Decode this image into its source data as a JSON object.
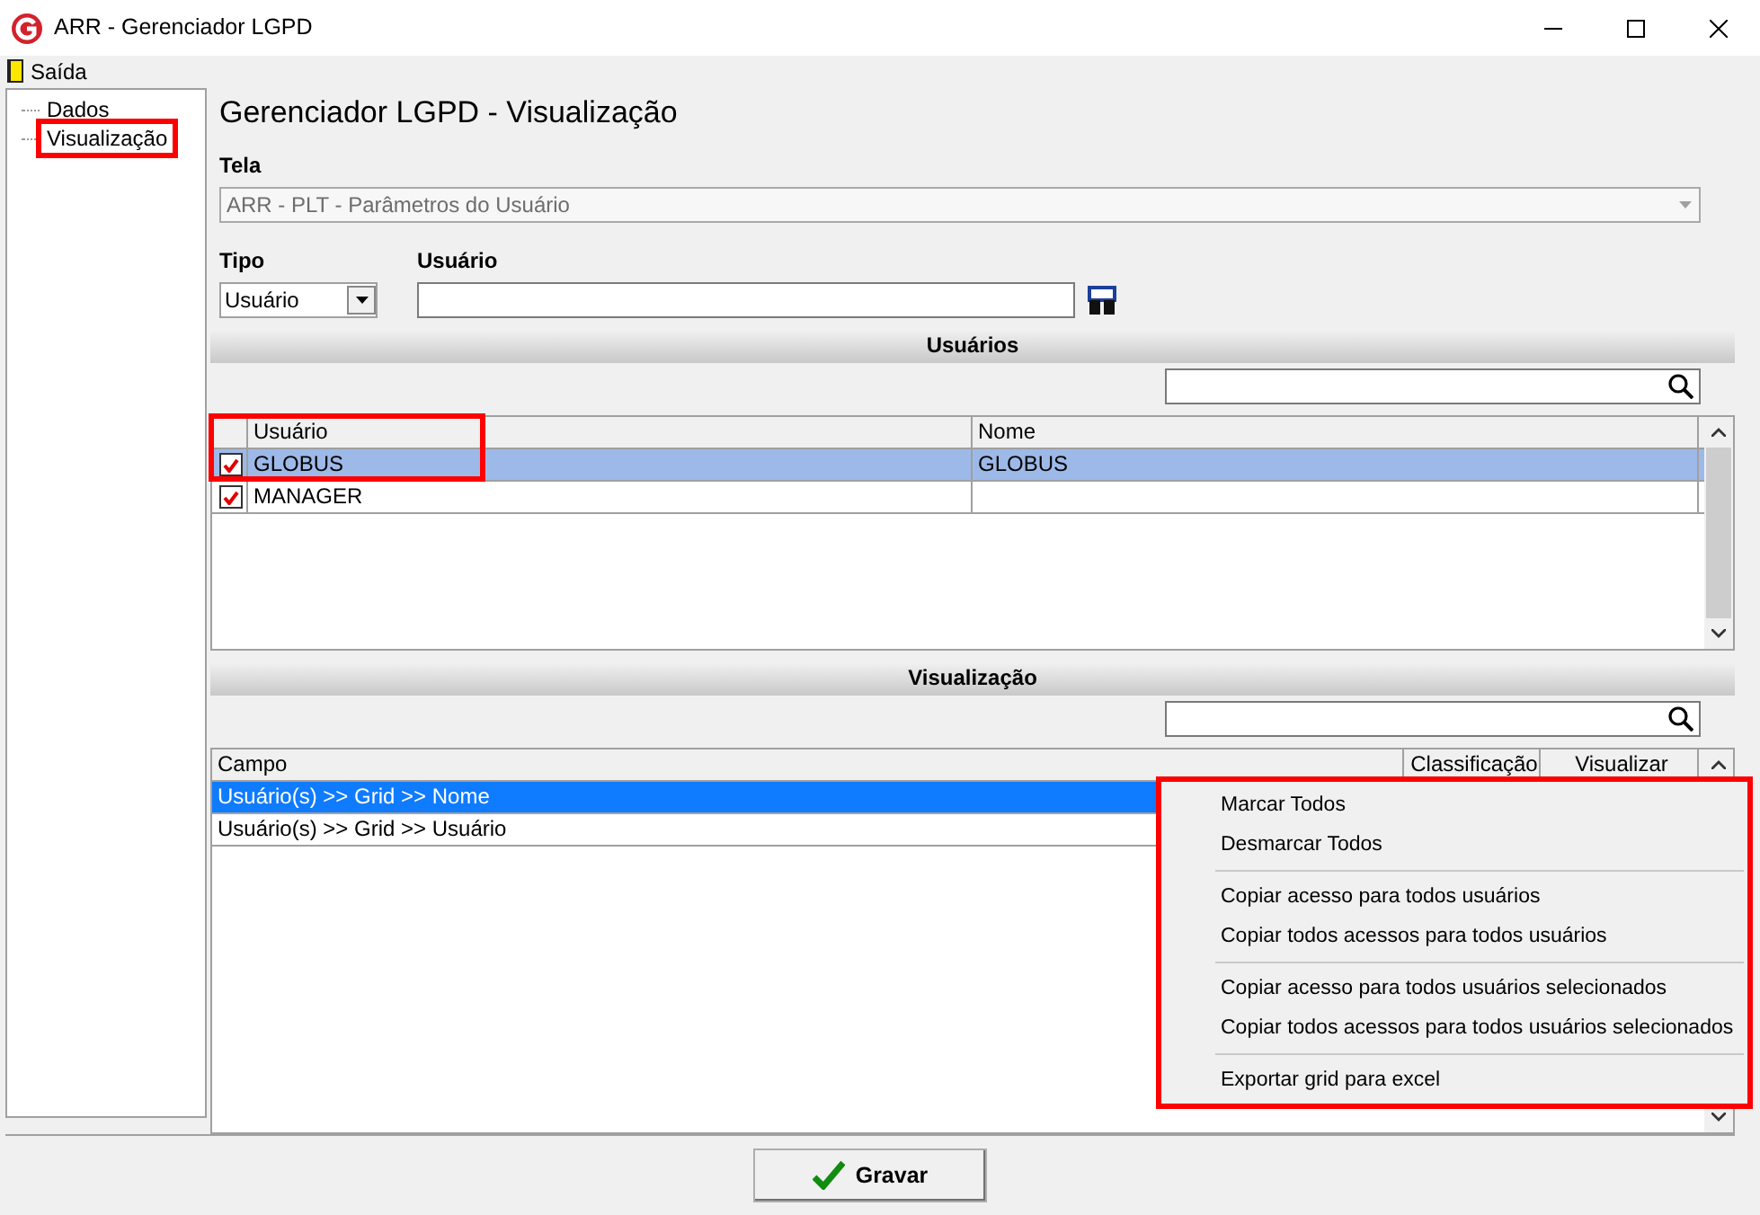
{
  "window": {
    "title": "ARR - Gerenciador LGPD"
  },
  "menu": [
    {
      "label": "Saída"
    }
  ],
  "tree": [
    {
      "label": "Dados",
      "highlighted": false
    },
    {
      "label": "Visualização",
      "highlighted": true
    }
  ],
  "page_title": "Gerenciador LGPD - Visualização",
  "tela": {
    "label": "Tela",
    "value": "ARR - PLT - Parâmetros do Usuário",
    "disabled": true
  },
  "tipo": {
    "label": "Tipo",
    "value": "Usuário"
  },
  "usuario": {
    "label": "Usuário"
  },
  "usuarios": {
    "title": "Usuários",
    "highlighted": true,
    "columns": [
      "Usuário",
      "Nome"
    ],
    "rows": [
      {
        "checked": true,
        "selected": true,
        "cells": [
          "GLOBUS",
          "GLOBUS"
        ]
      },
      {
        "checked": true,
        "selected": false,
        "cells": [
          "MANAGER"
        ]
      }
    ]
  },
  "visualizacao": {
    "title": "Visualização",
    "columns": [
      "Campo",
      "Classificação",
      "Visualizar"
    ],
    "rows": [
      {
        "selected": true,
        "cells": [
          "Usuário(s) >> Grid >> Nome"
        ]
      },
      {
        "selected": false,
        "cells": [
          "Usuário(s) >> Grid >> Usuário"
        ]
      }
    ]
  },
  "context_menu": {
    "highlighted": true,
    "groups": [
      [
        "Marcar Todos",
        "Desmarcar Todos"
      ],
      [
        "Copiar acesso para todos usuários",
        "Copiar todos acessos para todos usuários"
      ],
      [
        "Copiar acesso para todos usuários selecionados",
        "Copiar todos acessos para todos usuários selecionados"
      ],
      [
        "Exportar grid para excel"
      ]
    ]
  },
  "buttons": [
    {
      "label": "Gravar"
    }
  ]
}
